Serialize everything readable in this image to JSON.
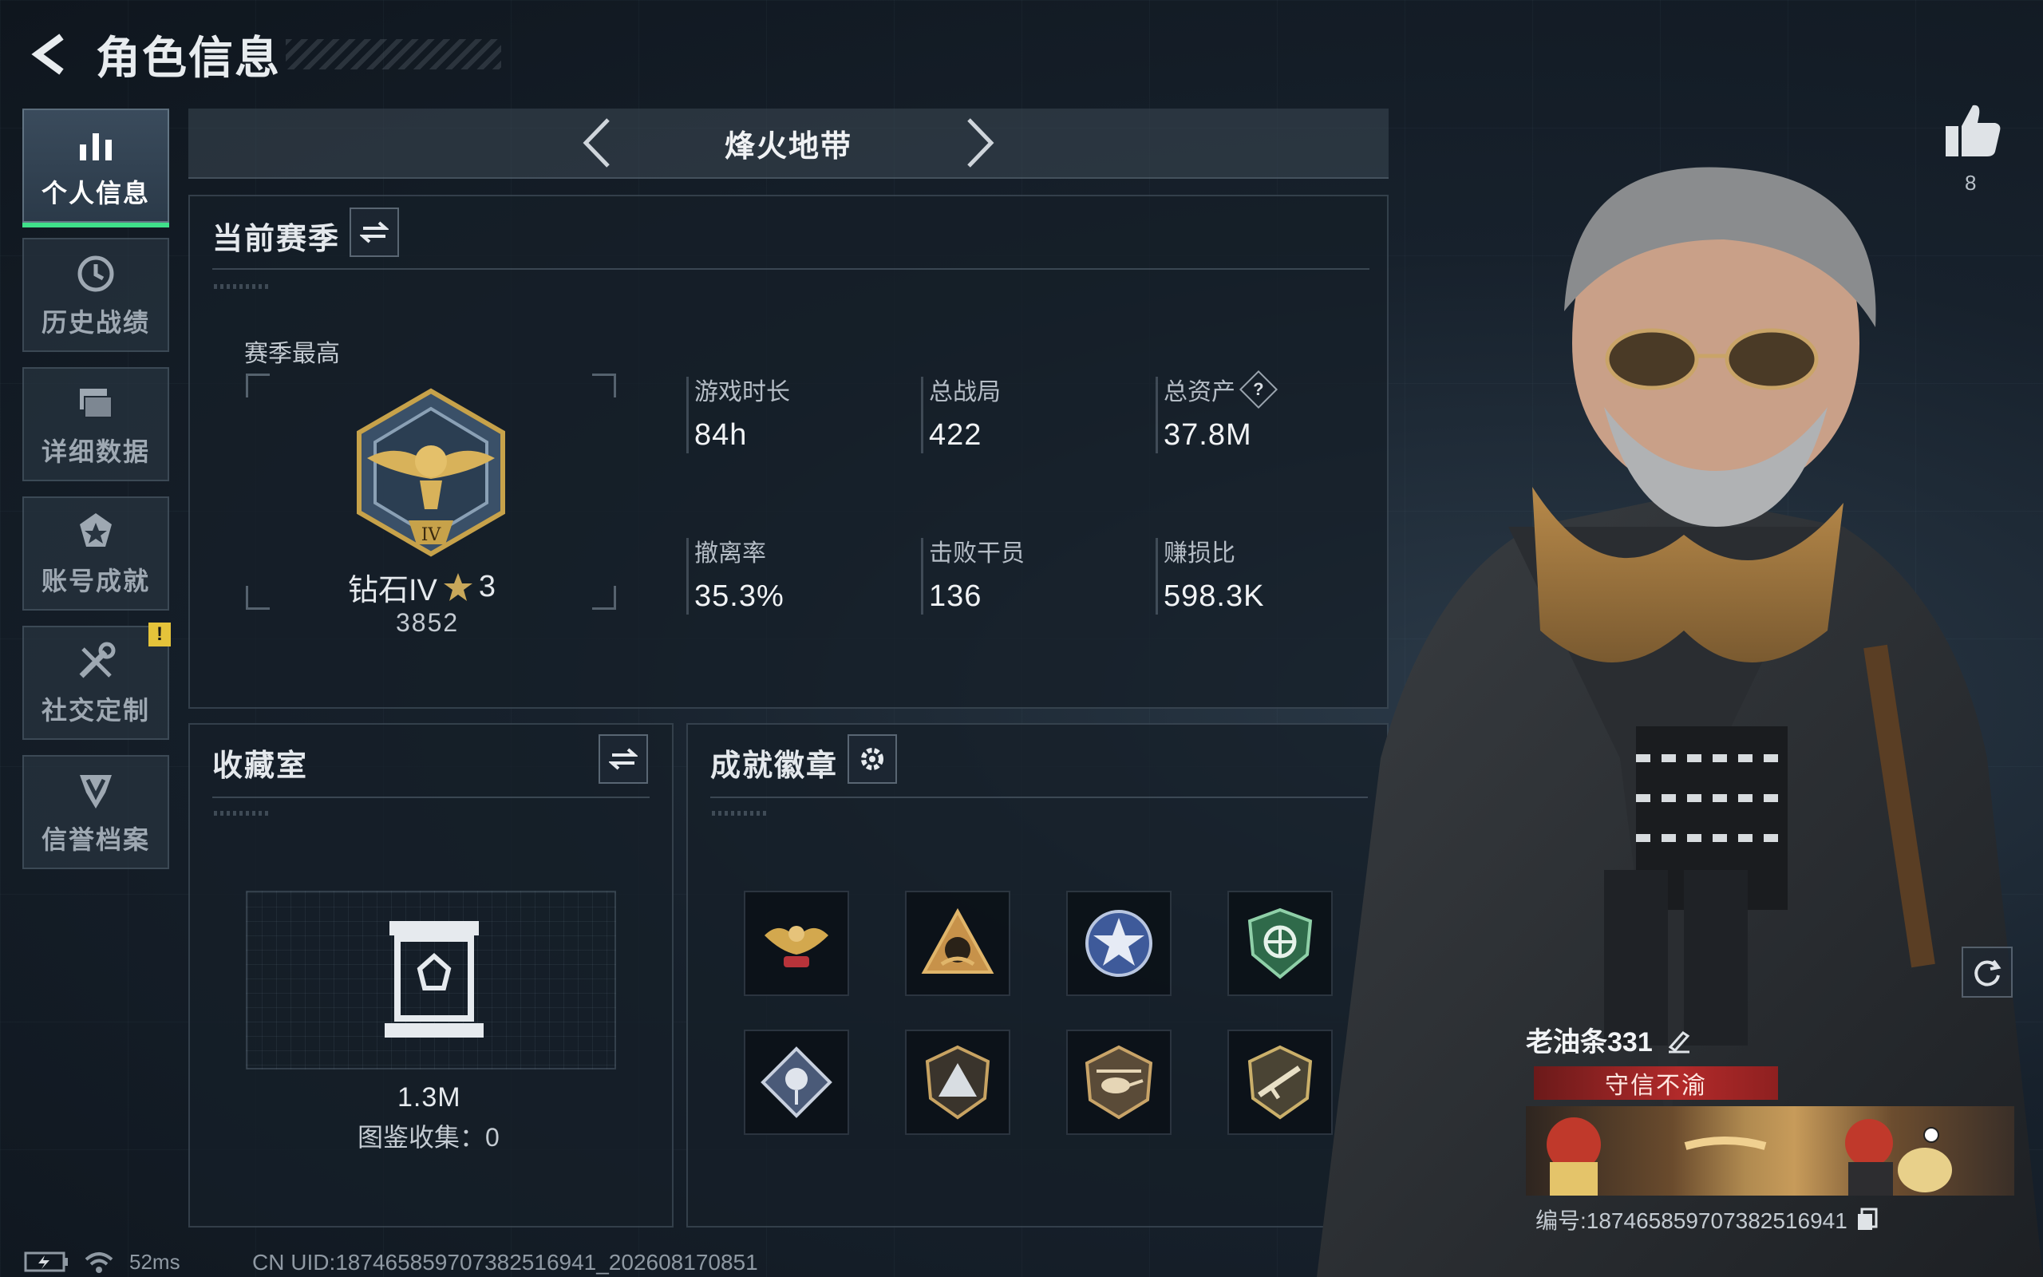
{
  "header": {
    "title": "角色信息"
  },
  "sidebar": {
    "items": [
      {
        "label": "个人信息",
        "icon": "bar-chart-icon"
      },
      {
        "label": "历史战绩",
        "icon": "history-clock-icon"
      },
      {
        "label": "详细数据",
        "icon": "folders-icon"
      },
      {
        "label": "账号成就",
        "icon": "achievement-icon"
      },
      {
        "label": "社交定制",
        "icon": "tools-icon",
        "badge": "!"
      },
      {
        "label": "信誉档案",
        "icon": "shield-v-icon"
      }
    ]
  },
  "mode": {
    "title": "烽火地带"
  },
  "season": {
    "title": "当前赛季",
    "subtitle": "赛季最高",
    "rank_name": "钻石IV",
    "rank_stars": "3",
    "rank_score": "3852",
    "stats": [
      {
        "label": "游戏时长",
        "value": "84h"
      },
      {
        "label": "总战局",
        "value": "422"
      },
      {
        "label": "总资产",
        "value": "37.8M",
        "help": "?"
      },
      {
        "label": "撤离率",
        "value": "35.3%"
      },
      {
        "label": "击败干员",
        "value": "136"
      },
      {
        "label": "赚损比",
        "value": "598.3K"
      }
    ]
  },
  "collection": {
    "title": "收藏室",
    "value": "1.3M",
    "count_text": "图鉴收集：0"
  },
  "badges": {
    "title": "成就徽章",
    "items": [
      "eagle-badge-icon",
      "mountain-sun-badge-icon",
      "star-shield-badge-icon",
      "green-shield-badge-icon",
      "rose-diamond-badge-icon",
      "peak-shield-badge-icon",
      "helicopter-badge-icon",
      "rifle-shield-badge-icon"
    ]
  },
  "likes": {
    "count": "8"
  },
  "player": {
    "name": "老油条331",
    "title": "守信不渝",
    "id_text": "编号:187465859707382516941"
  },
  "status": {
    "ping": "52ms",
    "uid": "CN UID:187465859707382516941_202608170851"
  },
  "colors": {
    "accent_green": "#3fe08a",
    "warning_yellow": "#e5c33a",
    "title_red": "#b22a2a",
    "background": "#17212c"
  }
}
